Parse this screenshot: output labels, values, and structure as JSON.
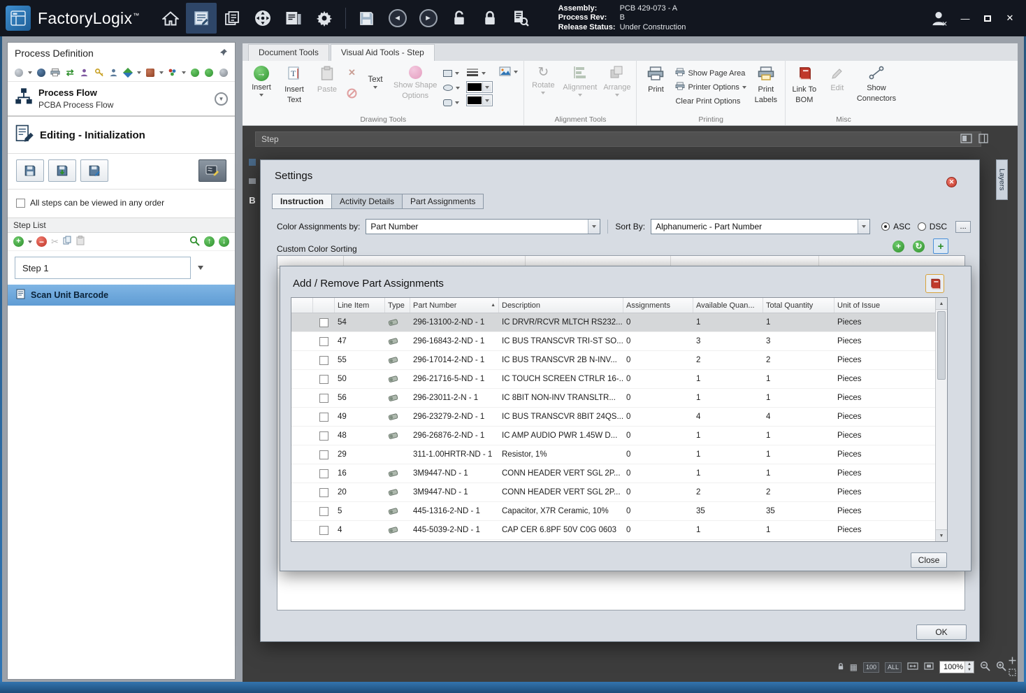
{
  "titlebar": {
    "app_name": "FactoryLogix",
    "trademark": "™",
    "assembly": {
      "label": "Assembly:",
      "value": "PCB 429-073 - A"
    },
    "process_rev": {
      "label": "Process Rev:",
      "value": "B"
    },
    "release_status": {
      "label": "Release Status:",
      "value": "Under Construction"
    }
  },
  "left_panel": {
    "title": "Process Definition",
    "process_flow": {
      "title": "Process Flow",
      "subtitle": "PCBA Process Flow"
    },
    "editing_header": "Editing - Initialization",
    "order_checkbox_label": "All steps can be viewed in any order",
    "step_list": {
      "title": "Step List",
      "dropdown_value": "Step 1",
      "selected_step": "Scan Unit Barcode"
    }
  },
  "ribbon": {
    "tabs": [
      {
        "label": "Document Tools",
        "active": false
      },
      {
        "label": "Visual Aid Tools - Step",
        "active": true
      }
    ],
    "drawing": {
      "group_label": "Drawing Tools",
      "insert_label": "Insert",
      "insert_text_line1": "Insert",
      "insert_text_line2": "Text",
      "paste_label": "Paste",
      "text_label": "Text",
      "show_shape_line1": "Show Shape",
      "show_shape_line2": "Options"
    },
    "alignment": {
      "group_label": "Alignment Tools",
      "rotate_label": "Rotate",
      "alignment_label": "Alignment",
      "arrange_label": "Arrange"
    },
    "printing": {
      "group_label": "Printing",
      "print_label": "Print",
      "show_page_area": "Show Page Area",
      "printer_options": "Printer Options",
      "clear_print_options": "Clear Print Options",
      "print_labels_line1": "Print",
      "print_labels_line2": "Labels"
    },
    "misc": {
      "group_label": "Misc",
      "link_to_bom_line1": "Link To",
      "link_to_bom_line2": "BOM",
      "edit_label": "Edit",
      "show_connectors_line1": "Show",
      "show_connectors_line2": "Connectors"
    }
  },
  "canvas": {
    "step_bar_label": "Step",
    "layers_tab_label": "Layers",
    "hidden_panel_letter": "B"
  },
  "settings": {
    "title": "Settings",
    "tabs": [
      {
        "label": "Instruction",
        "active": false
      },
      {
        "label": "Activity Details",
        "active": false
      },
      {
        "label": "Part Assignments",
        "active": true
      }
    ],
    "color_assignments_label": "Color Assignments by:",
    "color_assignments_value": "Part Number",
    "sort_by_label": "Sort By:",
    "sort_by_value": "Alphanumeric - Part Number",
    "asc_label": "ASC",
    "dsc_label": "DSC",
    "more_button_label": "...",
    "custom_color_sorting_label": "Custom Color Sorting",
    "ok_button_label": "OK"
  },
  "part_dialog": {
    "title": "Add / Remove Part Assignments",
    "close_button_label": "Close",
    "columns": [
      "Line Item",
      "Type",
      "Part Number",
      "Description",
      "Assignments",
      "Available Quan...",
      "Total Quantity",
      "Unit of Issue"
    ],
    "rows": [
      {
        "line": "54",
        "part": "296-13100-2-ND - 1",
        "desc": "IC DRVR/RCVR MLTCH RS232...",
        "asg": "0",
        "avail": "1",
        "total": "1",
        "unit": "Pieces",
        "selected": true,
        "type_icon": true
      },
      {
        "line": "47",
        "part": "296-16843-2-ND - 1",
        "desc": "IC BUS TRANSCVR TRI-ST SO...",
        "asg": "0",
        "avail": "3",
        "total": "3",
        "unit": "Pieces",
        "selected": false,
        "type_icon": true
      },
      {
        "line": "55",
        "part": "296-17014-2-ND - 1",
        "desc": "IC BUS TRANSCVR 2B N-INV...",
        "asg": "0",
        "avail": "2",
        "total": "2",
        "unit": "Pieces",
        "selected": false,
        "type_icon": true
      },
      {
        "line": "50",
        "part": "296-21716-5-ND - 1",
        "desc": "IC TOUCH SCREEN CTRLR 16-...",
        "asg": "0",
        "avail": "1",
        "total": "1",
        "unit": "Pieces",
        "selected": false,
        "type_icon": true
      },
      {
        "line": "56",
        "part": "296-23011-2-N - 1",
        "desc": "IC 8BIT NON-INV TRANSLTR...",
        "asg": "0",
        "avail": "1",
        "total": "1",
        "unit": "Pieces",
        "selected": false,
        "type_icon": true
      },
      {
        "line": "49",
        "part": "296-23279-2-ND - 1",
        "desc": "IC BUS TRANSCVR 8BIT 24QS...",
        "asg": "0",
        "avail": "4",
        "total": "4",
        "unit": "Pieces",
        "selected": false,
        "type_icon": true
      },
      {
        "line": "48",
        "part": "296-26876-2-ND - 1",
        "desc": "IC AMP AUDIO PWR 1.45W D...",
        "asg": "0",
        "avail": "1",
        "total": "1",
        "unit": "Pieces",
        "selected": false,
        "type_icon": true
      },
      {
        "line": "29",
        "part": "311-1.00HRTR-ND - 1",
        "desc": "Resistor, 1%",
        "asg": "0",
        "avail": "1",
        "total": "1",
        "unit": "Pieces",
        "selected": false,
        "type_icon": false
      },
      {
        "line": "16",
        "part": "3M9447-ND - 1",
        "desc": "CONN HEADER VERT SGL 2P...",
        "asg": "0",
        "avail": "1",
        "total": "1",
        "unit": "Pieces",
        "selected": false,
        "type_icon": true
      },
      {
        "line": "20",
        "part": "3M9447-ND - 1",
        "desc": "CONN HEADER VERT SGL 2P...",
        "asg": "0",
        "avail": "2",
        "total": "2",
        "unit": "Pieces",
        "selected": false,
        "type_icon": true
      },
      {
        "line": "5",
        "part": "445-1316-2-ND - 1",
        "desc": "Capacitor,  X7R Ceramic, 10%",
        "asg": "0",
        "avail": "35",
        "total": "35",
        "unit": "Pieces",
        "selected": false,
        "type_icon": true
      },
      {
        "line": "4",
        "part": "445-5039-2-ND - 1",
        "desc": "CAP CER 6.8PF 50V C0G 0603",
        "asg": "0",
        "avail": "1",
        "total": "1",
        "unit": "Pieces",
        "selected": false,
        "type_icon": true
      }
    ]
  },
  "statusbar": {
    "zoom_100": "100",
    "zoom_all": "ALL",
    "zoom_value": "100%"
  },
  "colors": {
    "accent_blue": "#2e75b6",
    "titlebar_bg": "#12161f",
    "selected_step_bg": "#5f9cd4",
    "close_red": "#c0392b",
    "selected_row_bg": "#d5d7d9",
    "canvas_bg": "#3d3d3d"
  }
}
